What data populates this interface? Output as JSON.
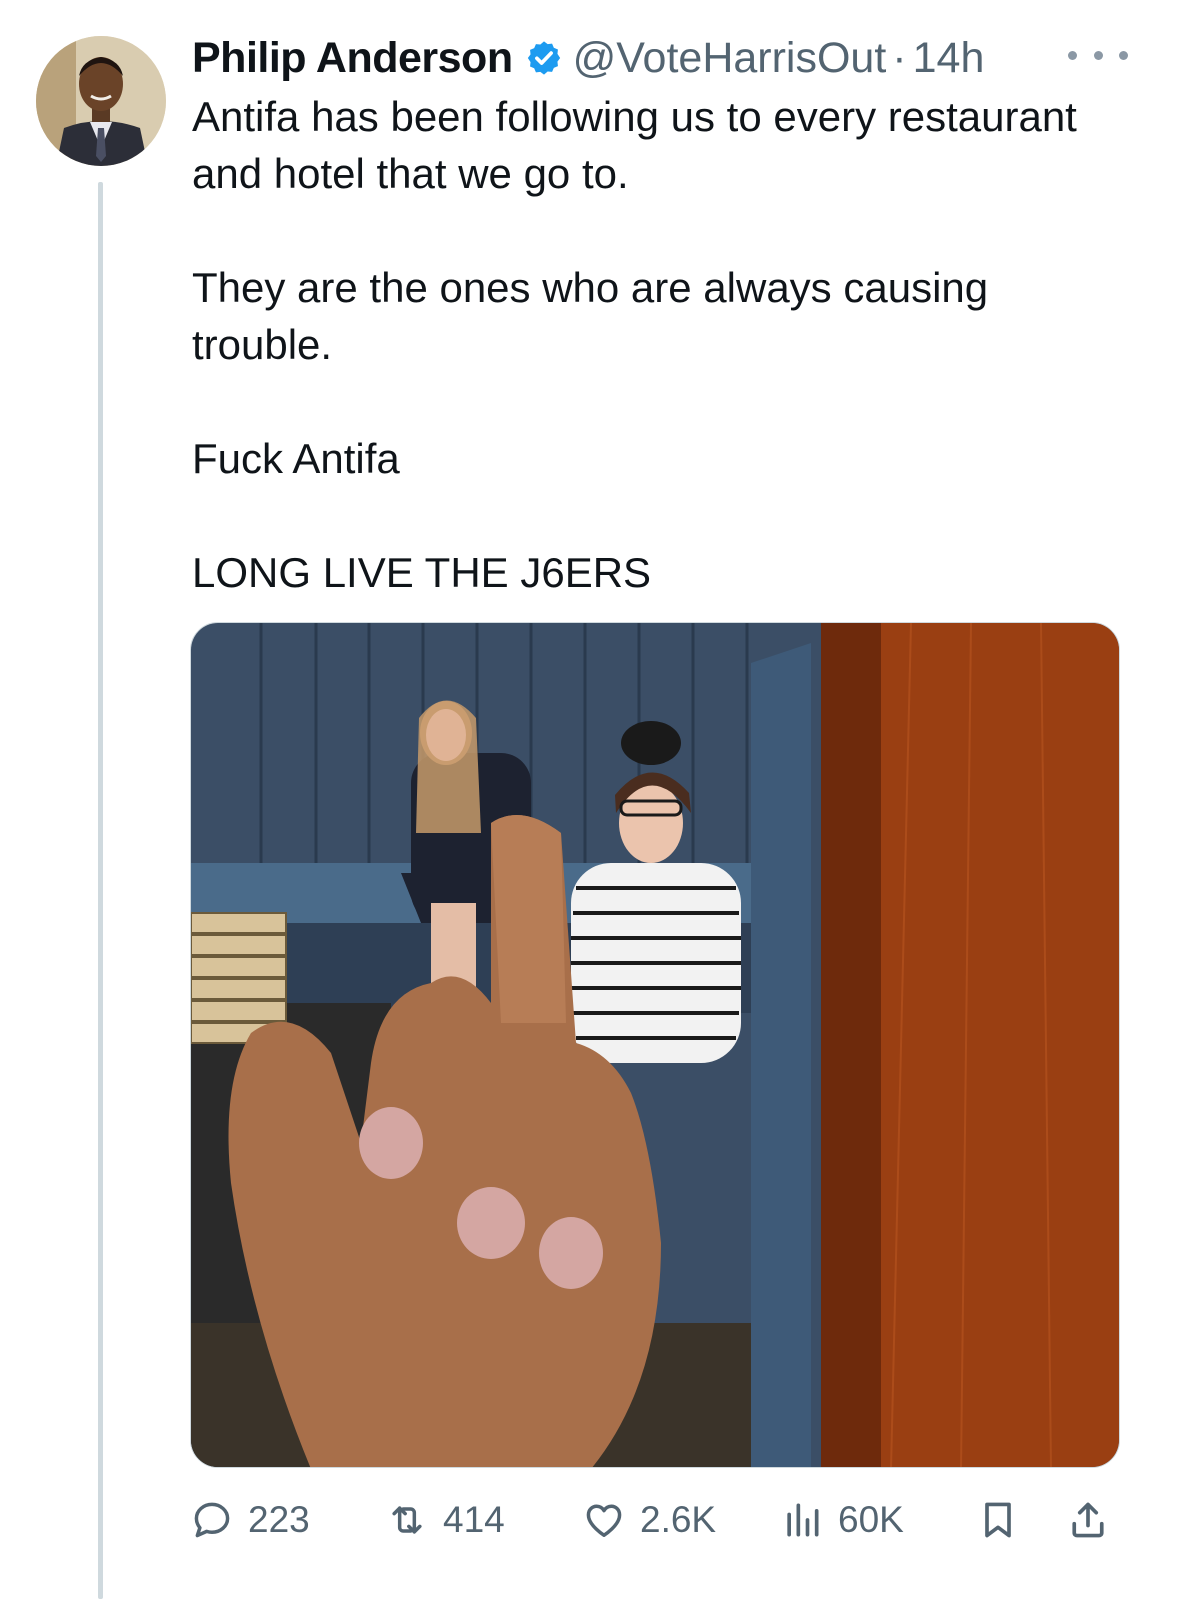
{
  "tweet": {
    "author_name": "Philip Anderson",
    "handle": "@VoteHarrisOut",
    "separator": "·",
    "time": "14h",
    "paragraphs": [
      "Antifa has been following us to every restaurant and hotel that we go to.",
      "They are the ones who are always causing trouble.",
      "Fuck Antifa",
      "LONG LIVE THE J6ERS"
    ]
  },
  "actions": {
    "replies": "223",
    "reposts": "414",
    "likes": "2.6K",
    "views": "60K"
  },
  "icons": {
    "verified": "verified-badge-icon",
    "more": "more-options-icon",
    "reply": "reply-icon",
    "repost": "repost-icon",
    "like": "heart-icon",
    "views": "views-chart-icon",
    "bookmark": "bookmark-icon",
    "share": "share-icon"
  },
  "colors": {
    "accent": "#1d9bf0",
    "secondary_text": "#536471",
    "icon_gray": "#536471"
  }
}
